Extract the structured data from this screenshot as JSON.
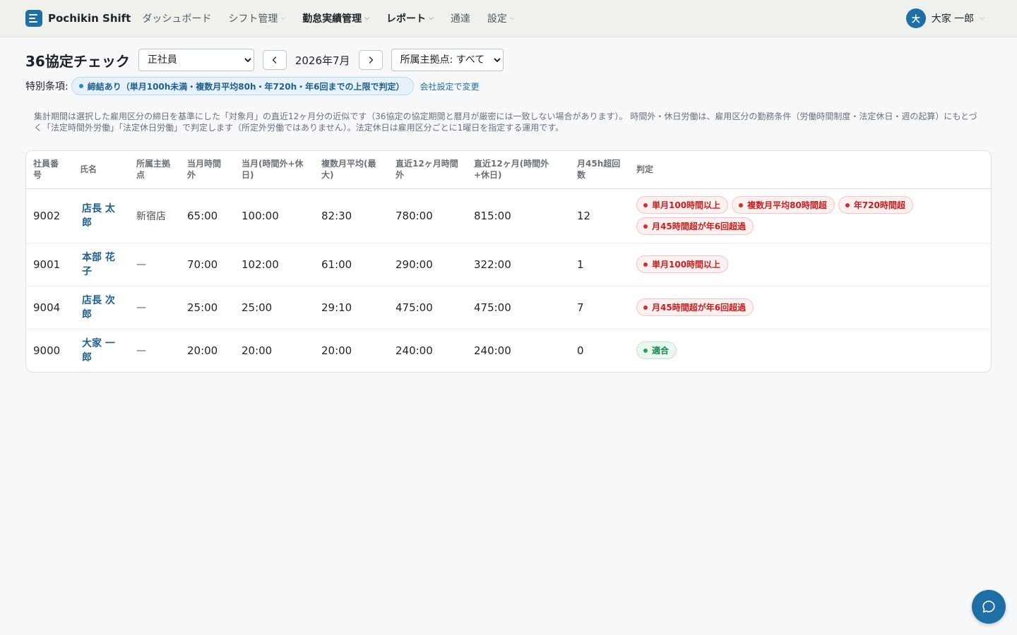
{
  "brand": {
    "name": "Pochikin Shift",
    "logo_icon": "menu-lines-icon",
    "color": "#1d6fa5"
  },
  "nav": {
    "items": [
      {
        "label": "ダッシュボード",
        "dropdown": false
      },
      {
        "label": "シフト管理",
        "dropdown": true
      },
      {
        "label": "勤怠実績管理",
        "dropdown": true,
        "active": true
      },
      {
        "label": "レポート",
        "dropdown": true,
        "active": true
      },
      {
        "label": "通達",
        "dropdown": false
      },
      {
        "label": "設定",
        "dropdown": true
      }
    ]
  },
  "user": {
    "avatar_initial": "大",
    "name": "大家 一郎"
  },
  "page": {
    "title": "36協定チェック",
    "employment_type": {
      "selected": "正社員"
    },
    "month": "2026年7月",
    "location_filter": {
      "selected": "所属主拠点: すべて"
    },
    "special_clause_label": "特別条項:",
    "special_clause_badge": "締結あり（単月100h未満・複数月平均80h・年720h・年6回までの上限で判定）",
    "company_settings_link": "会社設定で変更",
    "note": "集計期間は選択した雇用区分の締日を基準にした「対象月」の直近12ヶ月分の近似です（36協定の協定期間と暦月が厳密には一致しない場合があります）。 時間外・休日労働は、雇用区分の勤務条件（労働時間制度・法定休日・週の起算）にもとづく「法定時間外労働」「法定休日労働」で判定します（所定外労働ではありません）。法定休日は雇用区分ごとに1曜日を指定する運用です。"
  },
  "table": {
    "headers": {
      "emp_no": "社員番号",
      "name": "氏名",
      "location": "所属主拠点",
      "month_ot": "当月時間外",
      "month_ot_hol": "当月(時間外+休日)",
      "multi_avg": "複数月平均(最大)",
      "y12_ot": "直近12ヶ月時間外",
      "y12_ot_hol": "直近12ヶ月(時間外+休日)",
      "over45_count": "月45h超回数",
      "judgement": "判定"
    },
    "rows": [
      {
        "emp_no": "9002",
        "name": "店長 太郎",
        "location": "新宿店",
        "month_ot": "65:00",
        "month_ot_hol": "100:00",
        "multi_avg": "82:30",
        "y12_ot": "780:00",
        "y12_ot_hol": "815:00",
        "over45_count": "12",
        "badges": [
          {
            "label": "単月100時間以上",
            "status": "red"
          },
          {
            "label": "複数月平均80時間超",
            "status": "red"
          },
          {
            "label": "年720時間超",
            "status": "red"
          },
          {
            "label": "月45時間超が年6回超過",
            "status": "red"
          }
        ]
      },
      {
        "emp_no": "9001",
        "name": "本部 花子",
        "location": "—",
        "month_ot": "70:00",
        "month_ot_hol": "102:00",
        "multi_avg": "61:00",
        "y12_ot": "290:00",
        "y12_ot_hol": "322:00",
        "over45_count": "1",
        "badges": [
          {
            "label": "単月100時間以上",
            "status": "red"
          }
        ]
      },
      {
        "emp_no": "9004",
        "name": "店長 次郎",
        "location": "—",
        "month_ot": "25:00",
        "month_ot_hol": "25:00",
        "multi_avg": "29:10",
        "y12_ot": "475:00",
        "y12_ot_hol": "475:00",
        "over45_count": "7",
        "badges": [
          {
            "label": "月45時間超が年6回超過",
            "status": "red"
          }
        ]
      },
      {
        "emp_no": "9000",
        "name": "大家 一郎",
        "location": "—",
        "month_ot": "20:00",
        "month_ot_hol": "20:00",
        "multi_avg": "20:00",
        "y12_ot": "240:00",
        "y12_ot_hol": "240:00",
        "over45_count": "0",
        "badges": [
          {
            "label": "適合",
            "status": "green"
          }
        ]
      }
    ]
  },
  "colors": {
    "danger": "#c81e1e",
    "success": "#148a57",
    "accent": "#1d6fa5"
  },
  "chat_fab_icon": "chat-bubble-icon"
}
